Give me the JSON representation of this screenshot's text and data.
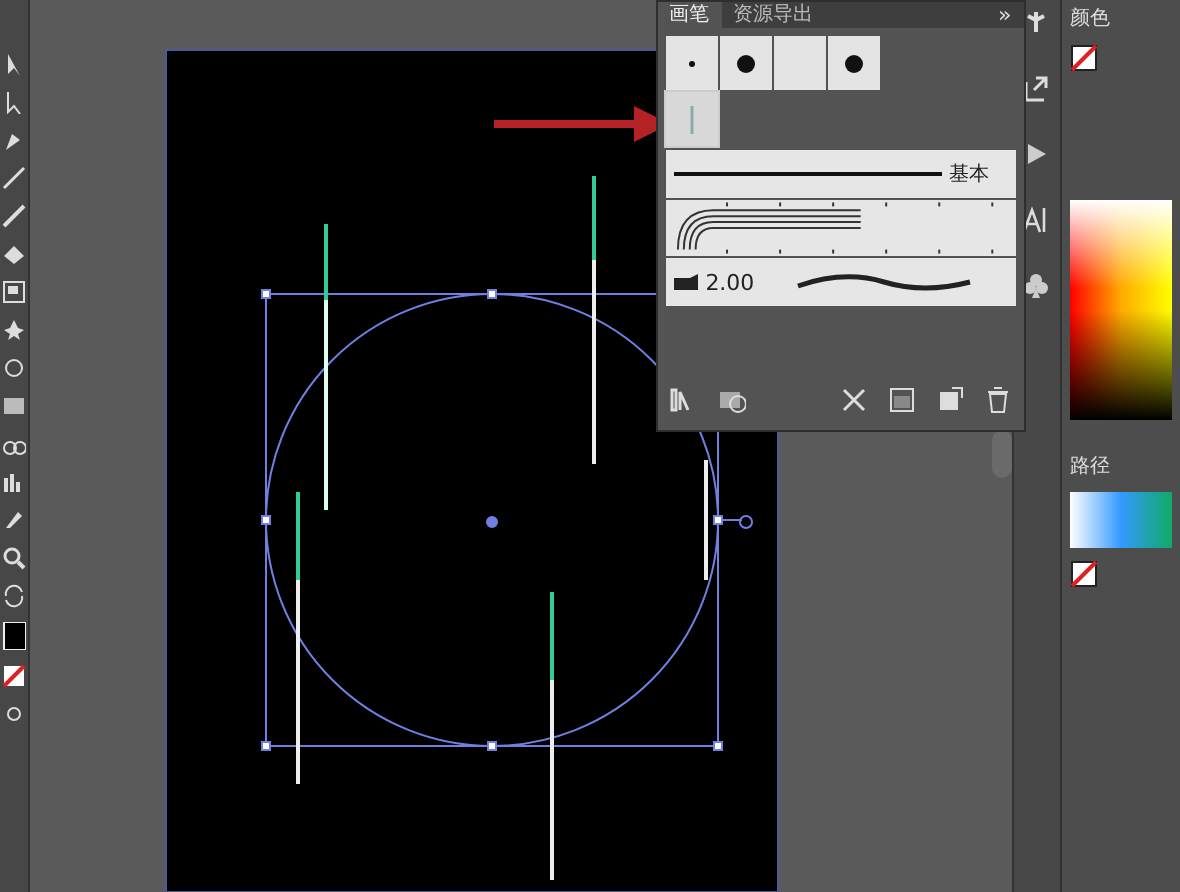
{
  "brushes_panel": {
    "tabs": [
      {
        "label": "画笔",
        "selected": true
      },
      {
        "label": "资源导出",
        "selected": false
      }
    ],
    "overflow": "»",
    "swatches": [
      {
        "kind": "dot-small",
        "selected": false
      },
      {
        "kind": "dot-large",
        "selected": false
      },
      {
        "kind": "blank",
        "selected": false
      },
      {
        "kind": "dot-large",
        "selected": false
      },
      {
        "kind": "line",
        "selected": true
      }
    ],
    "brush_rows": [
      {
        "kind": "basic",
        "label": "基本"
      },
      {
        "kind": "pattern"
      },
      {
        "kind": "calligraphic",
        "size": "2.00"
      }
    ]
  },
  "right_panel": {
    "title": "颜色",
    "section": "路径"
  }
}
